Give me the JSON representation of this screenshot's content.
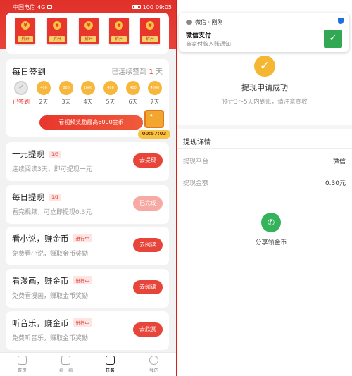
{
  "status_bar": {
    "carrier": "中国电信",
    "signal": "4G",
    "battery": "100",
    "time": "09:05"
  },
  "envelopes": [
    {
      "symbol": "¥",
      "label": "拆开"
    },
    {
      "symbol": "¥",
      "label": "拆开"
    },
    {
      "symbol": "¥",
      "label": "拆开"
    },
    {
      "symbol": "¥",
      "label": "拆开"
    },
    {
      "symbol": "¥",
      "label": "拆开"
    }
  ],
  "checkin": {
    "title": "每日签到",
    "streak_prefix": "已连续签到",
    "streak_count": "1",
    "streak_suffix": "天",
    "days": [
      {
        "coins": "",
        "label": "已签到",
        "done": true
      },
      {
        "coins": "400",
        "label": "2天"
      },
      {
        "coins": "800",
        "label": "3天"
      },
      {
        "coins": "1600",
        "label": "4天"
      },
      {
        "coins": "400",
        "label": "5天"
      },
      {
        "coins": "400",
        "label": "6天"
      },
      {
        "coins": "4000",
        "label": "7天"
      }
    ],
    "watch_button": "看视频奖励最高6000金币",
    "chest_timer": "00:57:03"
  },
  "tasks": [
    {
      "title": "一元提现",
      "tag": "1/3",
      "subtitle": "连续阅读3天，即可提现一元",
      "button": "去提现",
      "disabled": false
    },
    {
      "title": "每日提现",
      "tag": "1/1",
      "subtitle": "看完视频，可立即提现0.3元",
      "button": "已完成",
      "disabled": true
    },
    {
      "title": "看小说，赚金币",
      "tag": "进行中",
      "subtitle": "免费看小说，赚取金币奖励",
      "button": "去阅读",
      "disabled": false
    },
    {
      "title": "看漫画，赚金币",
      "tag": "进行中",
      "subtitle": "免费看漫画，赚取金币奖励",
      "button": "去阅读",
      "disabled": false
    },
    {
      "title": "听音乐，赚金币",
      "tag": "进行中",
      "subtitle": "免费听音乐，赚取金币奖励",
      "button": "去欣赏",
      "disabled": false
    }
  ],
  "tabbar": [
    {
      "label": "首页",
      "icon": "home-icon"
    },
    {
      "label": "看一看",
      "icon": "play-icon"
    },
    {
      "label": "任务",
      "icon": "edit-icon",
      "active": true
    },
    {
      "label": "我的",
      "icon": "user-icon"
    }
  ],
  "notification": {
    "app": "微信 · 刚刚",
    "title": "微信支付",
    "message": "商家付款入账通知",
    "pay_icon": "✓"
  },
  "result": {
    "title": "提现申请成功",
    "subtitle": "预计3～5天内到账，请注意查收"
  },
  "details": {
    "header": "提现详情",
    "platform_label": "提现平台",
    "platform_value": "微信",
    "amount_label": "提现金额",
    "amount_value": "0.30元"
  },
  "share": {
    "label": "分享领金币"
  },
  "colors": {
    "brand_red": "#e8362d",
    "gold": "#f6b73c",
    "wechat_green": "#34b35a"
  }
}
